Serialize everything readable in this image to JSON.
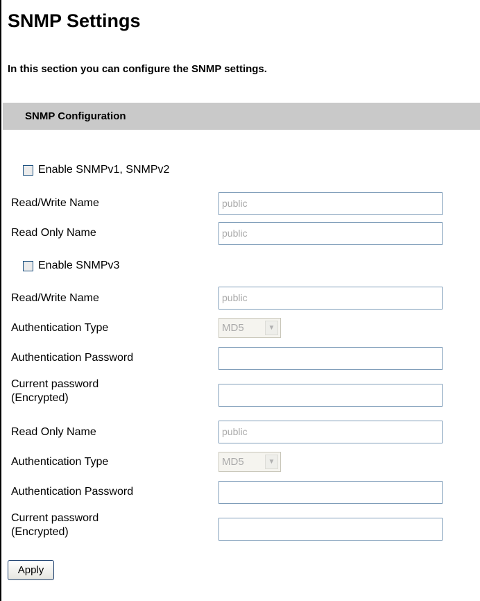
{
  "page": {
    "title": "SNMP Settings",
    "description": "In this section you can configure the SNMP settings."
  },
  "section": {
    "title": "SNMP Configuration"
  },
  "v1v2": {
    "checkbox_label": "Enable SNMPv1, SNMPv2",
    "checked": false,
    "read_write_label": "Read/Write Name",
    "read_write_value": "public",
    "read_only_label": "Read Only Name",
    "read_only_value": "public"
  },
  "v3": {
    "checkbox_label": "Enable SNMPv3",
    "checked": false,
    "read_write": {
      "name_label": "Read/Write Name",
      "name_value": "public",
      "auth_type_label": "Authentication Type",
      "auth_type_value": "MD5",
      "auth_password_label": "Authentication Password",
      "auth_password_value": "",
      "current_password_label_line1": "Current password",
      "current_password_label_line2": "(Encrypted)",
      "current_password_value": ""
    },
    "read_only": {
      "name_label": "Read Only Name",
      "name_value": "public",
      "auth_type_label": "Authentication Type",
      "auth_type_value": "MD5",
      "auth_password_label": "Authentication Password",
      "auth_password_value": "",
      "current_password_label_line1": "Current password",
      "current_password_label_line2": "(Encrypted)",
      "current_password_value": ""
    }
  },
  "actions": {
    "apply_label": "Apply"
  },
  "icons": {
    "dropdown": "chevron-down-icon"
  }
}
